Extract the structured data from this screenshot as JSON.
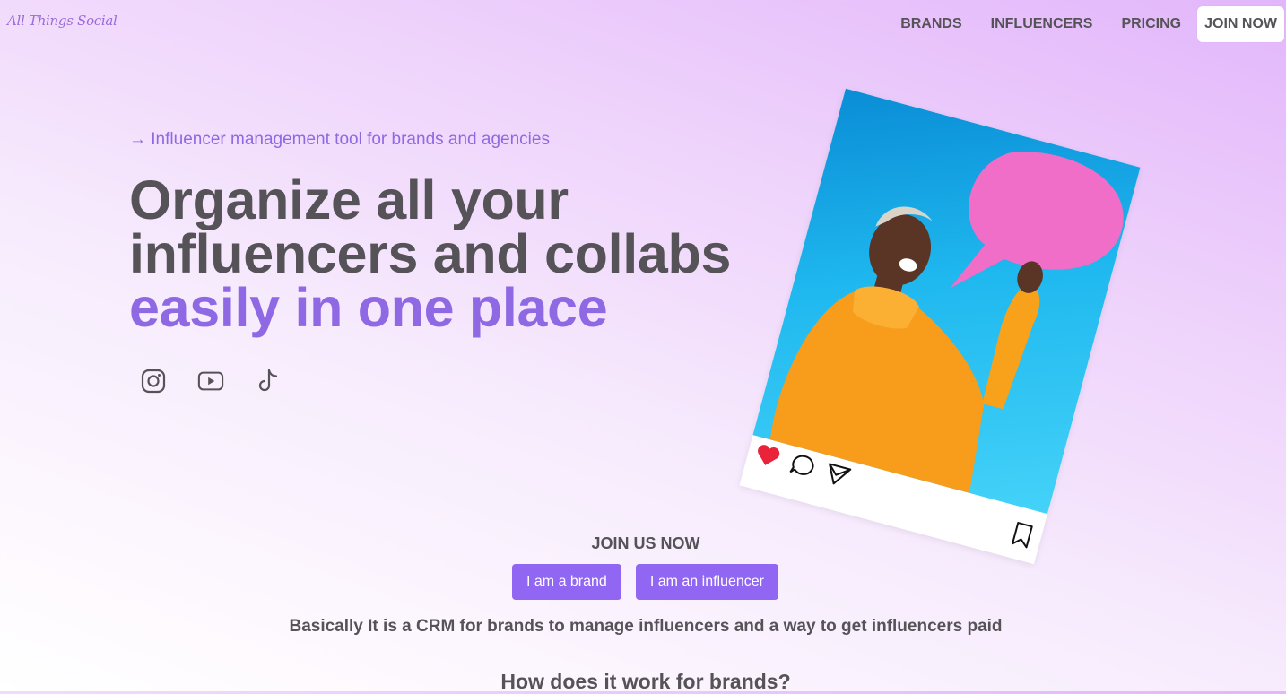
{
  "header": {
    "logo": "All Things Social",
    "nav": {
      "brands": "BRANDS",
      "influencers": "INFLUENCERS",
      "pricing": "PRICING",
      "join": "JOIN NOW"
    }
  },
  "hero": {
    "tagline": "→ Influencer management tool for brands and agencies",
    "headline_line1": "Organize all your",
    "headline_line2": "influencers and collabs",
    "headline_accent": "easily in one place",
    "social_icons": [
      "instagram-icon",
      "youtube-icon",
      "tiktok-icon"
    ]
  },
  "post_card": {
    "actions": [
      "heart-icon",
      "comment-icon",
      "send-icon"
    ],
    "save": "bookmark-icon"
  },
  "join": {
    "title": "JOIN US NOW",
    "brand_button": "I am a brand",
    "influencer_button": "I am an influencer"
  },
  "description": "Basically It is a CRM for brands to manage influencers and a way to get influencers paid",
  "how_title": "How does it work for brands?",
  "colors": {
    "accent": "#8f68e4",
    "button": "#9166f2",
    "text": "#555357",
    "heart": "#e8233a"
  }
}
